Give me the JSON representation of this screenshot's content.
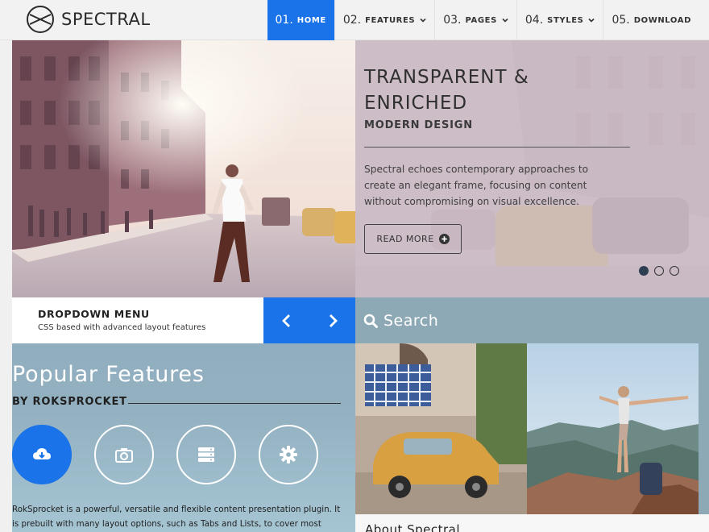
{
  "header": {
    "logo_text": "SPECTRAL",
    "nav": [
      {
        "num": "01.",
        "label": "HOME",
        "active": true,
        "dropdown": false
      },
      {
        "num": "02.",
        "label": "FEATURES",
        "active": false,
        "dropdown": true
      },
      {
        "num": "03.",
        "label": "PAGES",
        "active": false,
        "dropdown": true
      },
      {
        "num": "04.",
        "label": "STYLES",
        "active": false,
        "dropdown": true
      },
      {
        "num": "05.",
        "label": "DOWNLOAD",
        "active": false,
        "dropdown": false
      }
    ]
  },
  "hero": {
    "title": "TRANSPARENT & ENRICHED",
    "subtitle": "MODERN DESIGN",
    "text": "Spectral echoes contemporary approaches to create an elegant frame, focusing on content without compromising on visual excellence.",
    "button_label": "READ MORE",
    "slide_count": 3,
    "active_slide": 1
  },
  "dropdown_box": {
    "title": "DROPDOWN MENU",
    "subtitle": "CSS based with advanced layout features"
  },
  "search": {
    "placeholder": "Search"
  },
  "features": {
    "title": "Popular Features",
    "subtitle": "BY ROKSPROCKET",
    "icons": [
      "cloud-download-icon",
      "camera-icon",
      "server-icon",
      "gear-icon"
    ],
    "body": "RokSprocket is a powerful, versatile and flexible content presentation plugin. It is prebuilt with many layout options, such as Tabs and Lists, to cover most desired"
  },
  "about": {
    "title": "About Spectral"
  },
  "colors": {
    "accent": "#1a73e8",
    "left_panel": "#93b1c1",
    "right_panel": "#8ea9b6",
    "hero_overlay": "#d0c2cd"
  }
}
